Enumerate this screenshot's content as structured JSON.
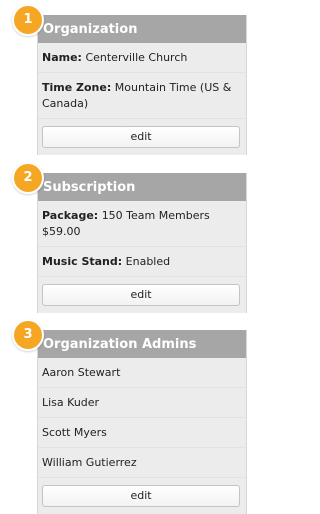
{
  "accent_color": "#f5a623",
  "header_color": "#a6a6a6",
  "organization": {
    "step": "1",
    "title": "Organization",
    "name_label": "Name:",
    "name_value": "Centerville Church",
    "timezone_label": "Time Zone:",
    "timezone_value": "Mountain Time (US & Canada)",
    "edit_label": "edit"
  },
  "subscription": {
    "step": "2",
    "title": "Subscription",
    "package_label": "Package:",
    "package_value": "150 Team Members",
    "price": "$59.00",
    "music_stand_label": "Music Stand:",
    "music_stand_value": "Enabled",
    "edit_label": "edit"
  },
  "admins": {
    "step": "3",
    "title": "Organization Admins",
    "names": [
      "Aaron Stewart",
      "Lisa Kuder",
      "Scott Myers",
      "William Gutierrez"
    ],
    "edit_label": "edit"
  }
}
